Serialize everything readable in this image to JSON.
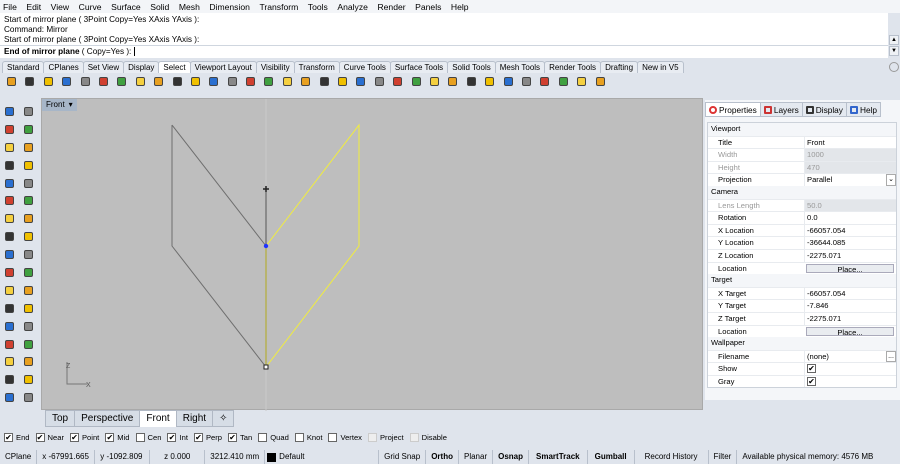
{
  "menu": [
    "File",
    "Edit",
    "View",
    "Curve",
    "Surface",
    "Solid",
    "Mesh",
    "Dimension",
    "Transform",
    "Tools",
    "Analyze",
    "Render",
    "Panels",
    "Help"
  ],
  "command": {
    "history": [
      "Start of mirror plane ( 3Point  Copy=Yes  XAxis  YAxis ):",
      "Command: Mirror",
      "Start of mirror plane ( 3Point  Copy=Yes  XAxis  YAxis ):"
    ],
    "prompt_bold": "End of mirror plane",
    "prompt_rest": " ( Copy=Yes ):"
  },
  "toolbar_tabs": [
    "Standard",
    "CPlanes",
    "Set View",
    "Display",
    "Select",
    "Viewport Layout",
    "Visibility",
    "Transform",
    "Curve Tools",
    "Surface Tools",
    "Solid Tools",
    "Mesh Tools",
    "Render Tools",
    "Drafting",
    "New in V5"
  ],
  "active_toolbar_tab": "Select",
  "toolbar_icons": [
    "select-points-icon",
    "select-point-clouds-icon",
    "select-curves-icon",
    "select-surfaces-icon",
    "select-polycurves-icon",
    "select-lights-icon",
    "select-blocks-icon",
    "select-polysurfaces-icon",
    "select-by-color-icon",
    "select-meshes-icon",
    "select-control-points-icon",
    "select-point-cloud-icon",
    "select-open-surfaces-icon",
    "select-annotations-icon",
    "select-hatches-icon",
    "select-dims-icon",
    "select-clipping-icon",
    "select-by-layer-icon",
    "select-solid-icon",
    "select-open-poly-icon",
    "select-planar-icon",
    "select-mesh-icon",
    "select-spiral-icon",
    "select-details-icon",
    "select-bad-icon",
    "select-pyramid-icon",
    "select-sphere-icon",
    "select-box-icon",
    "select-light-icon",
    "select-render-icon",
    "select-brush-icon",
    "select-search-icon",
    "select-filter-icon"
  ],
  "left_icons": [
    "select-arrow-icon",
    "point-icon",
    "polyline-icon",
    "curve-icon",
    "circle-icon",
    "ellipse-icon",
    "arc-icon",
    "rectangle-icon",
    "polygon-icon",
    "fillet-curve-icon",
    "surface-corner-icon",
    "surface-edge-icon",
    "box-icon",
    "sphere-icon",
    "extrude-icon",
    "mesh-icon",
    "boolean-icon",
    "explode-icon",
    "trim-icon",
    "split-icon",
    "group-icon",
    "points-icon",
    "offset-icon",
    "blend-icon",
    "text-icon",
    "scale-icon",
    "array-icon",
    "align-icon",
    "make2d-icon",
    "dim-icon",
    "grid-icon",
    "ruler-icon",
    "layout-icon",
    "more-icon"
  ],
  "viewport": {
    "label": "Front",
    "axis_z": "Z",
    "axis_x": "X",
    "tabs": [
      "Top",
      "Perspective",
      "Front",
      "Right"
    ],
    "active_tab": "Front"
  },
  "osnap": [
    {
      "label": "End",
      "checked": true
    },
    {
      "label": "Near",
      "checked": true
    },
    {
      "label": "Point",
      "checked": true
    },
    {
      "label": "Mid",
      "checked": true
    },
    {
      "label": "Cen",
      "checked": false
    },
    {
      "label": "Int",
      "checked": true
    },
    {
      "label": "Perp",
      "checked": true
    },
    {
      "label": "Tan",
      "checked": true
    },
    {
      "label": "Quad",
      "checked": false
    },
    {
      "label": "Knot",
      "checked": false
    },
    {
      "label": "Vertex",
      "checked": false
    },
    {
      "label": "Project",
      "checked": false,
      "disabled": true
    },
    {
      "label": "Disable",
      "checked": false,
      "disabled": true
    }
  ],
  "status": {
    "cplane": "CPlane",
    "x": "x -67991.665",
    "y": "y -1092.809",
    "z": "z 0.000",
    "distance": "3212.410 mm",
    "layer": "Default",
    "grid_snap": "Grid Snap",
    "ortho": "Ortho",
    "planar": "Planar",
    "osnap": "Osnap",
    "smarttrack": "SmartTrack",
    "gumball": "Gumball",
    "record_history": "Record History",
    "filter": "Filter",
    "memory": "Available physical memory: 4576 MB"
  },
  "panel": {
    "tabs": [
      "Properties",
      "Layers",
      "Display",
      "Help"
    ],
    "active_tab": "Properties",
    "sections": [
      {
        "title": "Viewport",
        "rows": [
          {
            "k": "Title",
            "v": "Front"
          },
          {
            "k": "Width",
            "v": "1000",
            "dim": true
          },
          {
            "k": "Height",
            "v": "470",
            "dim": true
          },
          {
            "k": "Projection",
            "v": "Parallel",
            "dropdown": true
          }
        ]
      },
      {
        "title": "Camera",
        "rows": [
          {
            "k": "Lens Length",
            "v": "50.0",
            "dim": true
          },
          {
            "k": "Rotation",
            "v": "0.0"
          },
          {
            "k": "X Location",
            "v": "-66057.054"
          },
          {
            "k": "Y Location",
            "v": "-36644.085"
          },
          {
            "k": "Z Location",
            "v": "-2275.071"
          },
          {
            "k": "Location",
            "button": "Place..."
          }
        ]
      },
      {
        "title": "Target",
        "rows": [
          {
            "k": "X Target",
            "v": "-66057.054"
          },
          {
            "k": "Y Target",
            "v": "-7.846"
          },
          {
            "k": "Z Target",
            "v": "-2275.071"
          },
          {
            "k": "Location",
            "button": "Place..."
          }
        ]
      },
      {
        "title": "Wallpaper",
        "rows": [
          {
            "k": "Filename",
            "v": "(none)",
            "browse": "..."
          },
          {
            "k": "Show",
            "check": true
          },
          {
            "k": "Gray",
            "check": true
          }
        ]
      }
    ]
  },
  "colors": {
    "selected_curve": "#f2ee3c",
    "original_curve": "#6e6e6e",
    "viewport_bg": "#bebebe",
    "blue_point": "#1f33ff"
  }
}
